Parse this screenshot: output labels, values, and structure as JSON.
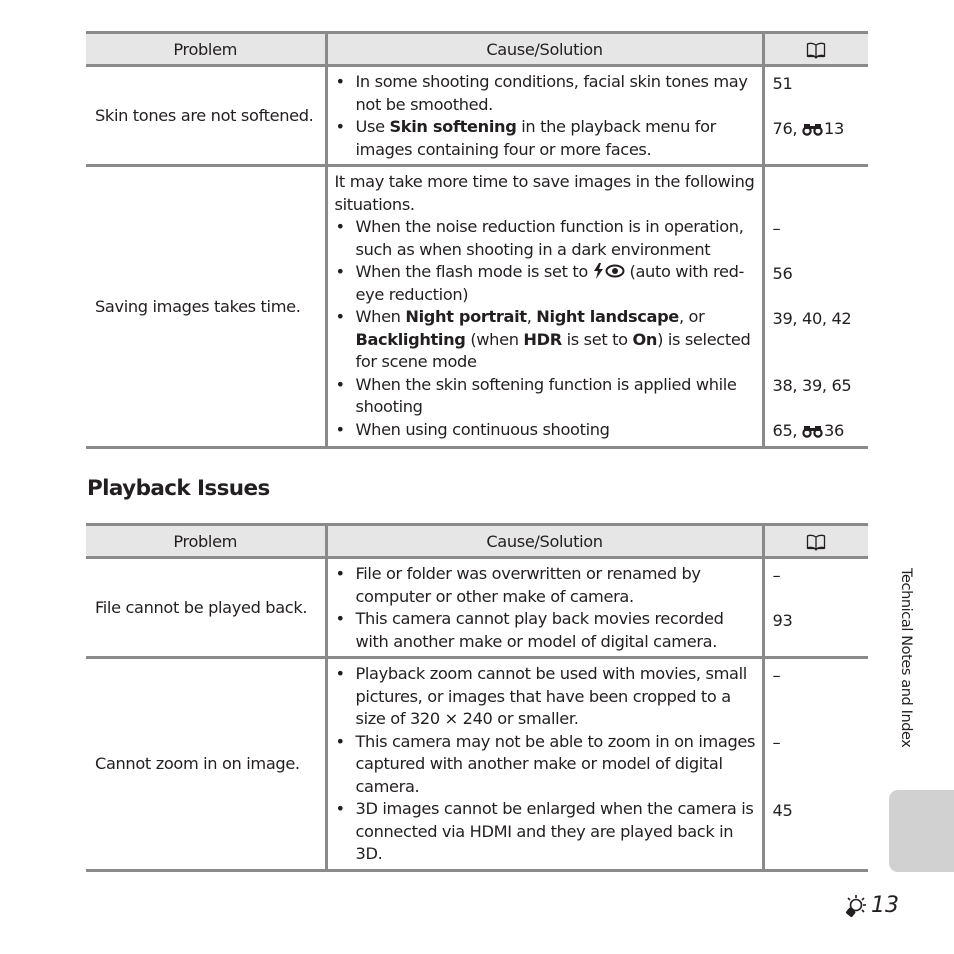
{
  "headers": {
    "problem": "Problem",
    "cause": "Cause/Solution",
    "ref_icon": "book-icon"
  },
  "table1": {
    "rows": [
      {
        "problem": "Skin tones are not softened.",
        "intro": "",
        "bullets": [
          {
            "parts": [
              {
                "t": "In some shooting conditions, facial skin tones may not be smoothed.",
                "b": false
              }
            ]
          },
          {
            "parts": [
              {
                "t": "Use ",
                "b": false
              },
              {
                "t": "Skin softening",
                "b": true
              },
              {
                "t": " in the playback menu for images containing four or more faces.",
                "b": false
              }
            ]
          }
        ],
        "refs": [
          {
            "text": "51",
            "icon": null,
            "suffix": ""
          },
          {
            "text": "76, ",
            "icon": "binoculars-icon",
            "suffix": "13"
          }
        ]
      },
      {
        "problem": "Saving images takes time.",
        "intro": "It may take more time to save images in the following situations.",
        "bullets": [
          {
            "parts": [
              {
                "t": "When the noise reduction function is in operation, such as when shooting in a dark environment",
                "b": false
              }
            ]
          },
          {
            "parts": [
              {
                "t": "When the flash mode is set to ",
                "b": false
              },
              {
                "icon": "flash-redeye-icon"
              },
              {
                "t": " (auto with red-eye reduction)",
                "b": false
              }
            ]
          },
          {
            "parts": [
              {
                "t": "When ",
                "b": false
              },
              {
                "t": "Night portrait",
                "b": true
              },
              {
                "t": ", ",
                "b": false
              },
              {
                "t": "Night landscape",
                "b": true
              },
              {
                "t": ", or ",
                "b": false
              },
              {
                "t": "Backlighting",
                "b": true
              },
              {
                "t": " (when ",
                "b": false
              },
              {
                "t": "HDR",
                "b": true
              },
              {
                "t": " is set to ",
                "b": false
              },
              {
                "t": "On",
                "b": true
              },
              {
                "t": ") is selected for scene mode",
                "b": false
              }
            ]
          },
          {
            "parts": [
              {
                "t": "When the skin softening function is applied while shooting",
                "b": false
              }
            ]
          },
          {
            "parts": [
              {
                "t": "When using continuous shooting",
                "b": false
              }
            ]
          }
        ],
        "refs": [
          {
            "text": "–",
            "icon": null,
            "suffix": ""
          },
          {
            "text": "56",
            "icon": null,
            "suffix": ""
          },
          {
            "text": "39, 40, 42",
            "icon": null,
            "suffix": ""
          },
          {
            "text": "38, 39, 65",
            "icon": null,
            "suffix": ""
          },
          {
            "text": "65, ",
            "icon": "binoculars-icon",
            "suffix": "36"
          }
        ]
      }
    ]
  },
  "section_title": "Playback Issues",
  "table2": {
    "rows": [
      {
        "problem": "File cannot be played back.",
        "intro": "",
        "bullets": [
          {
            "parts": [
              {
                "t": "File or folder was overwritten or renamed by computer or other make of camera.",
                "b": false
              }
            ]
          },
          {
            "parts": [
              {
                "t": "This camera cannot play back movies recorded with another make or model of digital camera.",
                "b": false
              }
            ]
          }
        ],
        "refs": [
          {
            "text": "–",
            "icon": null,
            "suffix": ""
          },
          {
            "text": "93",
            "icon": null,
            "suffix": ""
          }
        ]
      },
      {
        "problem": "Cannot zoom in on image.",
        "intro": "",
        "bullets": [
          {
            "parts": [
              {
                "t": "Playback zoom cannot be used with movies, small pictures, or images that have been cropped to a size of 320 × 240 or smaller.",
                "b": false
              }
            ]
          },
          {
            "parts": [
              {
                "t": "This camera may not be able to zoom in on images captured with another make or model of digital camera.",
                "b": false
              }
            ]
          },
          {
            "parts": [
              {
                "t": "3D images cannot be enlarged when the camera is connected via HDMI and they are played back in 3D.",
                "b": false
              }
            ]
          }
        ],
        "refs": [
          {
            "text": "–",
            "icon": null,
            "suffix": ""
          },
          {
            "text": "–",
            "icon": null,
            "suffix": ""
          },
          {
            "text": "45",
            "icon": null,
            "suffix": ""
          }
        ]
      }
    ]
  },
  "side_tab": {
    "label": "Technical Notes and Index"
  },
  "footer": {
    "page_icon": "lightbulb-icon",
    "page_number": "13"
  }
}
